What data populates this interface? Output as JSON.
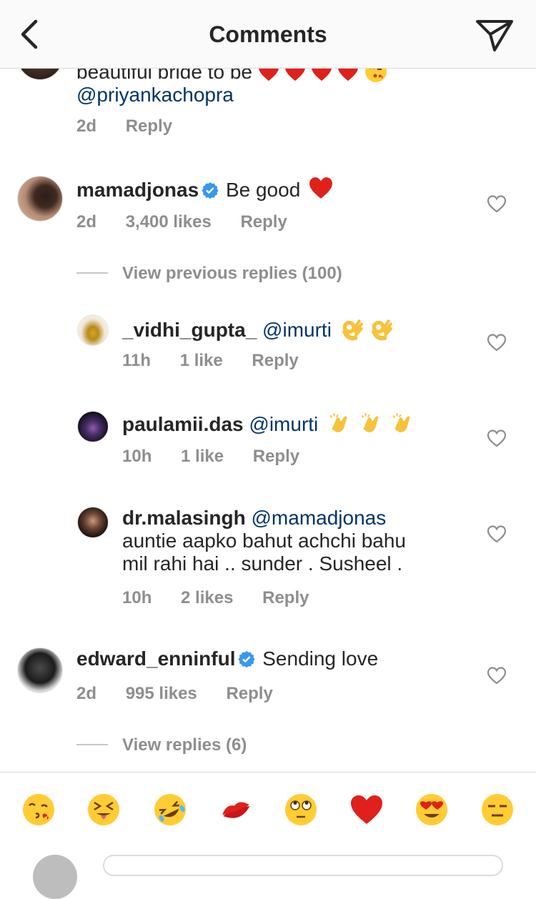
{
  "header": {
    "title": "Comments",
    "back_icon": "chevron-left-icon",
    "send_icon": "paper-plane-icon"
  },
  "comments": [
    {
      "partial_text": "beautiful bride to be",
      "mention": "@priyankachopra",
      "time": "2d",
      "reply_label": "Reply"
    },
    {
      "username": "mamadjonas",
      "verified": true,
      "text": "Be good",
      "time": "2d",
      "likes": "3,400 likes",
      "reply_label": "Reply"
    }
  ],
  "view_previous_replies": "View previous replies (100)",
  "replies": [
    {
      "username": "_vidhi_gupta_",
      "mention": "@imurti",
      "text": "",
      "time": "11h",
      "likes": "1 like",
      "reply_label": "Reply"
    },
    {
      "username": "paulamii.das",
      "mention": "@imurti",
      "text": "",
      "time": "10h",
      "likes": "1 like",
      "reply_label": "Reply"
    },
    {
      "username": "dr.malasingh",
      "mention": "@mamadjonas",
      "line1": "auntie aapko bahut achchi bahu",
      "line2": "mil rahi hai .. sunder . Susheel .",
      "time": "10h",
      "likes": "2 likes",
      "reply_label": "Reply"
    }
  ],
  "comment_edward": {
    "username": "edward_enninful",
    "verified": true,
    "text": "Sending love",
    "time": "2d",
    "likes": "995 likes",
    "reply_label": "Reply"
  },
  "view_replies": "View replies (6)",
  "emoji_bar": [
    "face-blowing-kiss-icon",
    "squinting-tongue-face-icon",
    "rolling-laughing-face-icon",
    "kiss-mark-icon",
    "eye-roll-face-icon",
    "red-heart-icon",
    "heart-eyes-face-icon",
    "expressionless-face-icon"
  ],
  "colors": {
    "mention": "#003569",
    "meta": "#8e8e8e",
    "verified": "#3897f0",
    "heart": "#e0201b"
  }
}
